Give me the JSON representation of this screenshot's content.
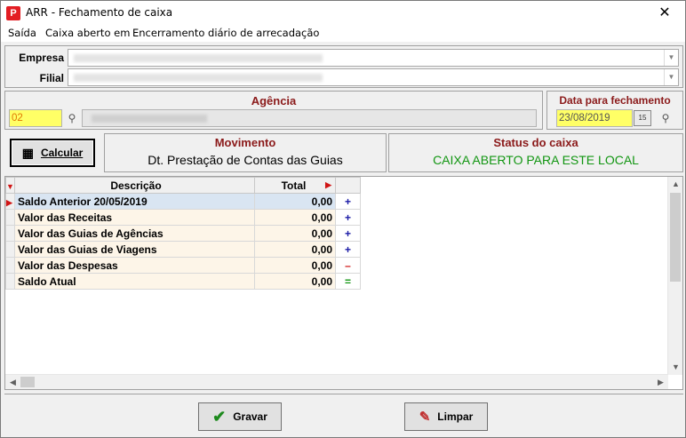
{
  "window": {
    "title": "ARR - Fechamento de caixa",
    "close_glyph": "✕",
    "app_icon": "P"
  },
  "menu": [
    {
      "label": "Saída"
    },
    {
      "label": "Caixa aberto em"
    },
    {
      "label": "Encerramento diário de arrecadação"
    }
  ],
  "company": {
    "empresa_label": "Empresa",
    "filial_label": "Filial"
  },
  "agencia": {
    "header": "Agência",
    "code": "02"
  },
  "data_fechamento": {
    "header": "Data para fechamento",
    "date": "23/08/2019",
    "calendar_glyph": "15"
  },
  "calcular_button": {
    "label": "Calcular"
  },
  "movimento": {
    "header": "Movimento",
    "value": "Dt. Prestação de Contas das Guias"
  },
  "status": {
    "header": "Status do caixa",
    "value": "CAIXA ABERTO PARA ESTE LOCAL",
    "color": "#129612"
  },
  "grid": {
    "columns": {
      "descricao": "Descrição",
      "total": "Total"
    },
    "rows": [
      {
        "descricao": "Saldo Anterior  20/05/2019",
        "total": "0,00",
        "sign": "+"
      },
      {
        "descricao": "Valor das Receitas",
        "total": "0,00",
        "sign": "+"
      },
      {
        "descricao": "Valor das Guias de Agências",
        "total": "0,00",
        "sign": "+"
      },
      {
        "descricao": "Valor das Guias de Viagens",
        "total": "0,00",
        "sign": "+"
      },
      {
        "descricao": "Valor das Despesas",
        "total": "0,00",
        "sign": "–"
      },
      {
        "descricao": "Saldo Atual",
        "total": "0,00",
        "sign": "="
      }
    ]
  },
  "buttons": {
    "gravar": "Gravar",
    "limpar": "Limpar"
  },
  "icons": {
    "binoculars": "binoculars-icon",
    "check": "checkmark-icon",
    "eraser": "eraser-icon",
    "calculator": "calculator-icon"
  }
}
